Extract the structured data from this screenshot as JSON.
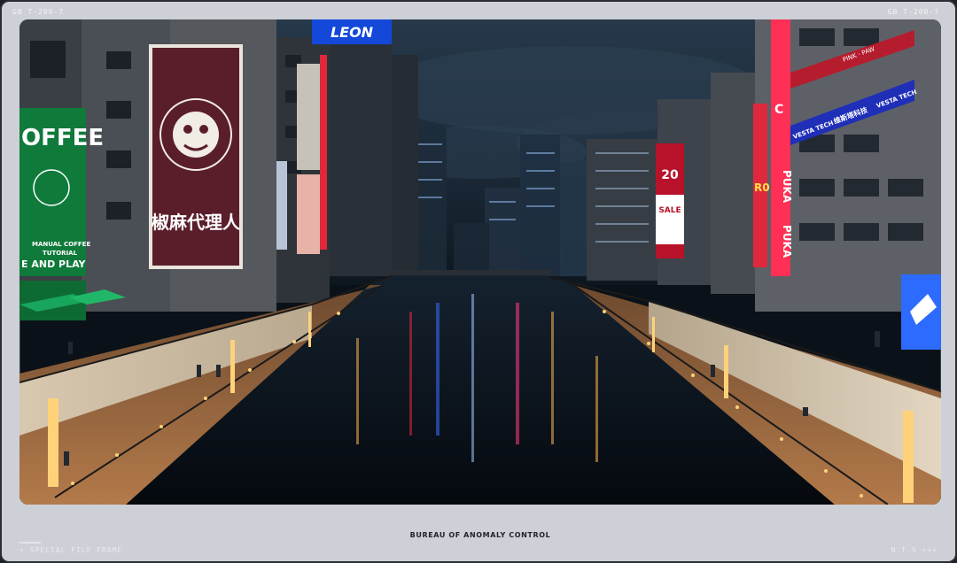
{
  "frame": {
    "top_left_label": "GB   T-200-7",
    "top_right_label": "GB   T-200-7",
    "bottom_left_label": "+ SPECIAL FILE FRAME",
    "bottom_right_label": "N.T.S +++",
    "caption": "BUREAU OF ANOMALY CONTROL"
  },
  "scene": {
    "signs": {
      "leon": "LEON",
      "coffee": "OFFEE",
      "coffee_line1": "MANUAL COFFEE",
      "coffee_line2": "TUTORIAL",
      "coffee_line3": "E AND PLAY",
      "lion_text": "椒麻代理人",
      "sale_top": "20",
      "sale": "SALE",
      "puka1": "PUKA",
      "puka2": "PUKA",
      "tech_left": "VESTA TECH",
      "tech_right": "VESTA TECH",
      "tech_cn": "维斯塔科技",
      "pink": "PINK · PAW",
      "code1": "C",
      "code2": "R0"
    },
    "colors": {
      "sky": "#1b2633",
      "water": "#0b141d",
      "walkway": "#a56e43",
      "wall": "#e2d4bf",
      "coffee_green": "#0f7a3a",
      "neon_red": "#e0283c",
      "neon_pink": "#ff3d7f",
      "neon_blue": "#3a6cff"
    }
  }
}
